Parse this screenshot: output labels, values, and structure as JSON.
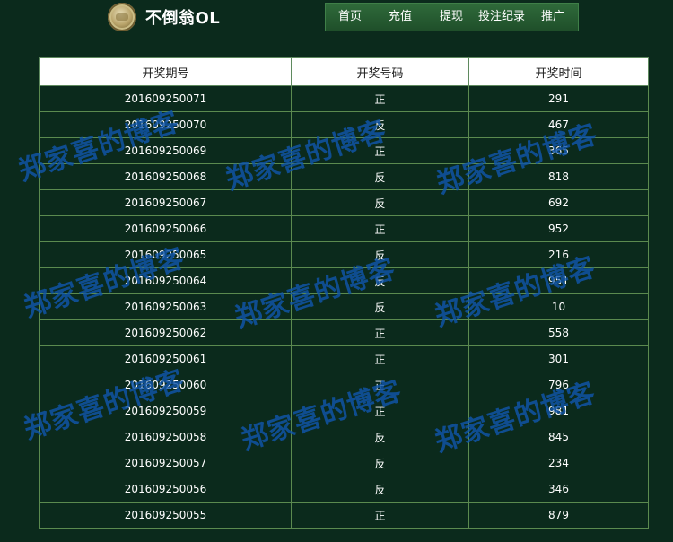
{
  "header": {
    "title": "不倒翁OL",
    "nav": [
      {
        "label": "首页"
      },
      {
        "label": "充值"
      },
      {
        "label": "提现"
      },
      {
        "label": "投注纪录"
      },
      {
        "label": "推广"
      }
    ]
  },
  "table": {
    "headers": [
      "开奖期号",
      "开奖号码",
      "开奖时间"
    ],
    "rows": [
      {
        "period": "201609250071",
        "result": "正",
        "time": "291"
      },
      {
        "period": "201609250070",
        "result": "反",
        "time": "467"
      },
      {
        "period": "201609250069",
        "result": "正",
        "time": "365"
      },
      {
        "period": "201609250068",
        "result": "反",
        "time": "818"
      },
      {
        "period": "201609250067",
        "result": "反",
        "time": "692"
      },
      {
        "period": "201609250066",
        "result": "正",
        "time": "952"
      },
      {
        "period": "201609250065",
        "result": "反",
        "time": "216"
      },
      {
        "period": "201609250064",
        "result": "反",
        "time": "951"
      },
      {
        "period": "201609250063",
        "result": "反",
        "time": "10"
      },
      {
        "period": "201609250062",
        "result": "正",
        "time": "558"
      },
      {
        "period": "201609250061",
        "result": "正",
        "time": "301"
      },
      {
        "period": "201609250060",
        "result": "正",
        "time": "796"
      },
      {
        "period": "201609250059",
        "result": "正",
        "time": "981"
      },
      {
        "period": "201609250058",
        "result": "反",
        "time": "845"
      },
      {
        "period": "201609250057",
        "result": "反",
        "time": "234"
      },
      {
        "period": "201609250056",
        "result": "反",
        "time": "346"
      },
      {
        "period": "201609250055",
        "result": "正",
        "time": "879"
      }
    ]
  },
  "watermark": {
    "text": "郑家喜的博客",
    "color": "#1055aa"
  },
  "colors": {
    "background": "#0b2a1c",
    "nav": "#2f6a3a",
    "grid": "#5b8a4f"
  },
  "icons": {
    "logo": "coin-logo-icon"
  }
}
